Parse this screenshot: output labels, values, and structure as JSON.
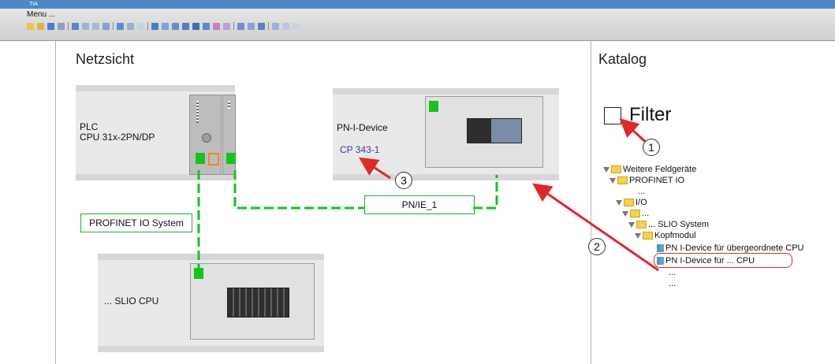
{
  "window": {
    "title": "TIA"
  },
  "menubar": {
    "menu_label": "Menu ..."
  },
  "network_view": {
    "title": "Netzsicht",
    "plc": {
      "name": "PLC",
      "model": "CPU 31x-2PN/DP"
    },
    "pn_device": {
      "name": "PN-I-Device",
      "model": "CP 343-1"
    },
    "slio_cpu": {
      "name": "... SLIO CPU"
    },
    "subnet_label": "PN/IE_1",
    "io_system_label": "PROFINET IO System"
  },
  "catalog": {
    "title": "Katalog",
    "filter_label": "Filter",
    "tree": [
      {
        "label": "Weitere Feldgeräte",
        "type": "folder",
        "expanded": true
      },
      {
        "label": "PROFINET IO",
        "type": "folder",
        "expanded": true
      },
      {
        "label": "...",
        "type": "text"
      },
      {
        "label": "I/O",
        "type": "folder",
        "expanded": true
      },
      {
        "label": "...",
        "type": "folder",
        "expanded": true
      },
      {
        "label": "... SLIO System",
        "type": "folder",
        "expanded": true
      },
      {
        "label": "Kopfmodul",
        "type": "folder",
        "expanded": true
      },
      {
        "label": "PN I-Device für übergeordnete CPU",
        "type": "module"
      },
      {
        "label": "PN I-Device für ... CPU",
        "type": "module",
        "highlighted": true
      },
      {
        "label": "...",
        "type": "text"
      },
      {
        "label": "...",
        "type": "text"
      }
    ]
  },
  "callouts": [
    "1",
    "2",
    "3"
  ],
  "colors": {
    "link": "#12c41e",
    "arrow": "#e0282a",
    "titlebar": "#4f86c6"
  }
}
